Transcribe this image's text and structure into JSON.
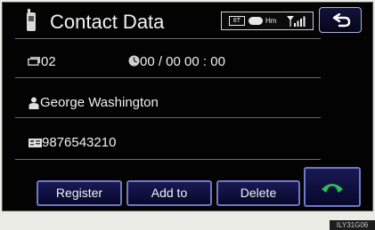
{
  "header": {
    "title": "Contact Data",
    "status": {
      "badge_label": "6T",
      "hands_free_label": "Hm",
      "bluetooth_icon": "bluetooth-icon",
      "signal_icon": "signal-strength-icon"
    },
    "back_icon": "return-arrow-icon"
  },
  "details": {
    "index": "02",
    "datetime": "00 / 00  00 : 00",
    "name": "George Washington",
    "phone": "9876543210"
  },
  "actions": {
    "register_label": "Register",
    "add_to_label": "Add to",
    "delete_label": "Delete",
    "call_icon": "phone-handset-icon"
  },
  "figure_code": "ILY31G06",
  "colors": {
    "screen_bg": "#030303",
    "button_border": "#6d78c8",
    "call_green": "#2dbd5a"
  }
}
